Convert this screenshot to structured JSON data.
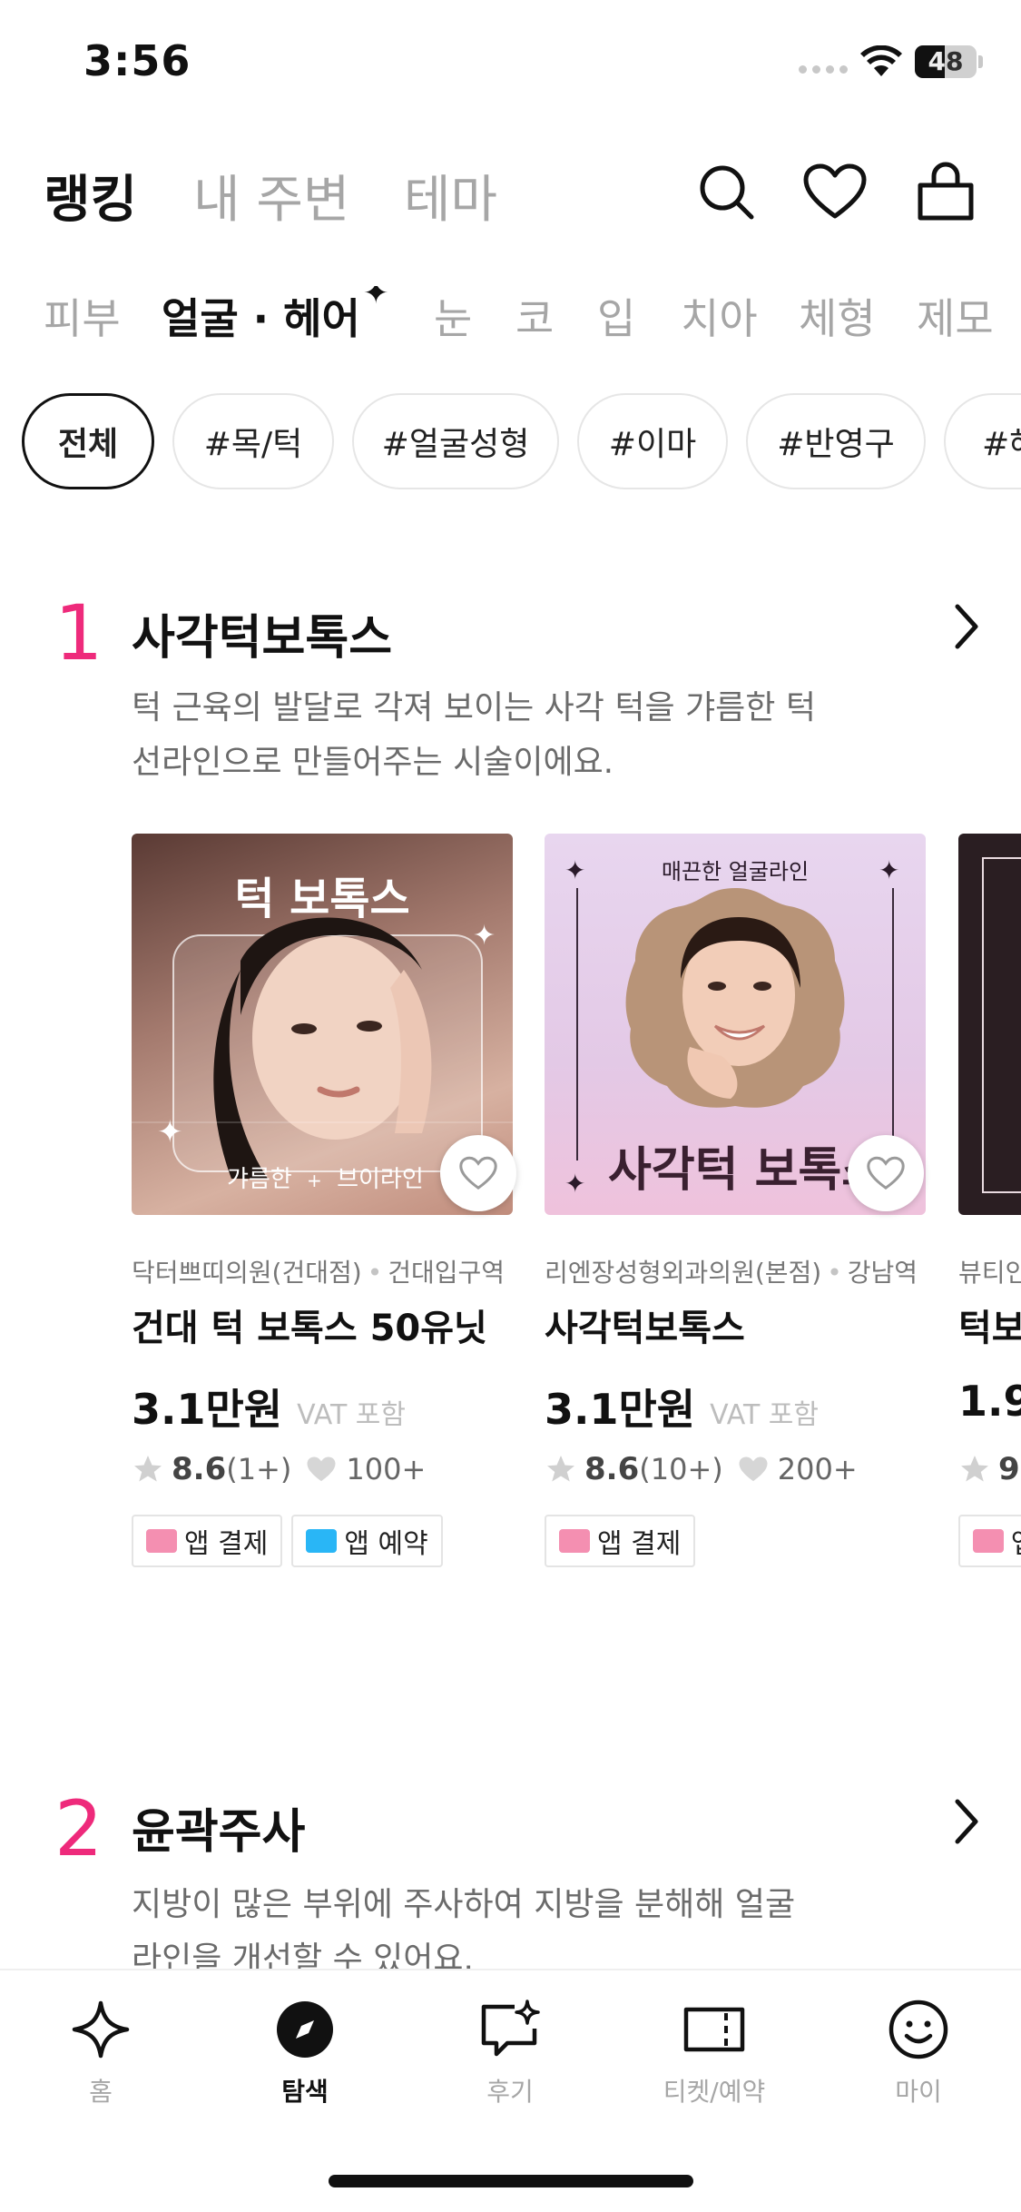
{
  "status_bar": {
    "time": "3:56",
    "battery": "48",
    "battery_level": 0.48
  },
  "top_nav": {
    "tabs": [
      {
        "label": "랭킹",
        "active": true
      },
      {
        "label": "내 주변",
        "active": false
      },
      {
        "label": "테마",
        "active": false
      }
    ]
  },
  "categories": [
    {
      "label": "피부",
      "active": false
    },
    {
      "label": "얼굴 · 헤어",
      "active": true
    },
    {
      "label": "눈",
      "active": false
    },
    {
      "label": "코",
      "active": false
    },
    {
      "label": "입",
      "active": false
    },
    {
      "label": "치아",
      "active": false
    },
    {
      "label": "체형",
      "active": false
    },
    {
      "label": "제모",
      "active": false
    }
  ],
  "chips": [
    "전체",
    "#목/턱",
    "#얼굴성형",
    "#이마",
    "#반영구",
    "#헤"
  ],
  "ranking": [
    {
      "rank": "1",
      "title": "사각턱보톡스",
      "description": "턱 근육의 발달로 각져 보이는 사각 턱을 갸름한 턱선라인으로 만들어주는 시술이에요.",
      "cards": [
        {
          "thumb_title": "턱 보톡스",
          "thumb_caption_left": "갸름한",
          "thumb_caption_sep": "+",
          "thumb_caption_right": "브이라인",
          "clinic": "닥터쁘띠의원(건대점)",
          "station": "건대입구역",
          "name": "건대 턱 보톡스 50유닛",
          "price": "3.1만원",
          "vat": "VAT 포함",
          "rating": "8.6",
          "reviews": "(1+)",
          "likes": "100+",
          "badges": [
            "앱 결제",
            "앱 예약"
          ]
        },
        {
          "thumb_top": "매끈한 얼굴라인",
          "thumb_title": "사각턱 보톡스",
          "clinic": "리엔장성형외과의원(본점)",
          "station": "강남역",
          "name": "사각턱보톡스",
          "price": "3.1만원",
          "vat": "VAT 포함",
          "rating": "8.6",
          "reviews": "(10+)",
          "likes": "200+",
          "badges": [
            "앱 결제"
          ]
        }
      ],
      "partial_card": {
        "clinic": "뷰티인",
        "name": "턱보",
        "price": "1.9",
        "rating": "9",
        "badge": "앱"
      }
    },
    {
      "rank": "2",
      "title": "윤곽주사",
      "description": "지방이 많은 부위에 주사하여 지방을 분해해 얼굴 라인을 개선할 수 있어요."
    }
  ],
  "bottom_nav": [
    {
      "label": "홈",
      "icon": "sparkle-icon",
      "active": false
    },
    {
      "label": "탐색",
      "icon": "compass-icon",
      "active": true
    },
    {
      "label": "후기",
      "icon": "review-icon",
      "active": false
    },
    {
      "label": "티켓/예약",
      "icon": "ticket-icon",
      "active": false
    },
    {
      "label": "마이",
      "icon": "smile-icon",
      "active": false
    }
  ],
  "colors": {
    "accent": "#ee2a7b",
    "text": "#111111",
    "muted": "#a6a6a6",
    "pay_badge": "#f48fb1",
    "reserve_badge": "#29b6f6"
  }
}
